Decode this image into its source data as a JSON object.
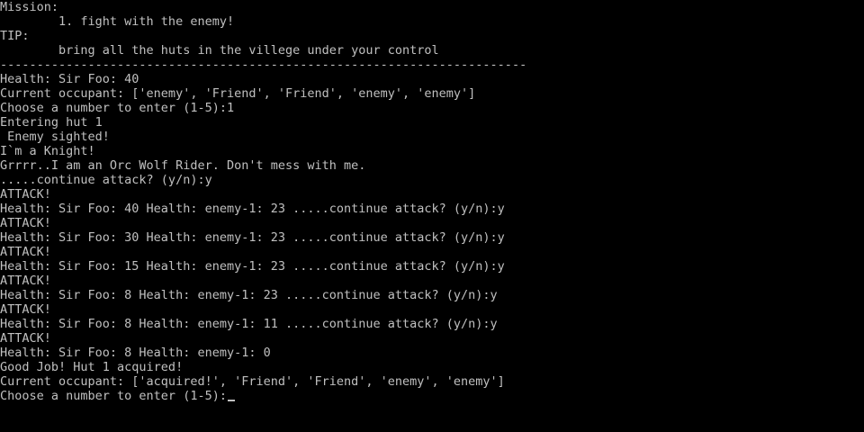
{
  "console": {
    "colors": {
      "background": "#000000",
      "text": "#c0c0c0"
    },
    "lines": [
      "Mission:",
      "        1. fight with the enemy!",
      "TIP:",
      "        bring all the huts in the villege under your control",
      "------------------------------------------------------------------------",
      "Health: Sir Foo: 40",
      "Current occupant: ['enemy', 'Friend', 'Friend', 'enemy', 'enemy']",
      "Choose a number to enter (1-5):1",
      "Entering hut 1",
      " Enemy sighted!",
      "I`m a Knight!",
      "Grrrr..I am an Orc Wolf Rider. Don't mess with me.",
      ".....continue attack? (y/n):y",
      "ATTACK!",
      "Health: Sir Foo: 40 Health: enemy-1: 23 .....continue attack? (y/n):y",
      "ATTACK!",
      "Health: Sir Foo: 30 Health: enemy-1: 23 .....continue attack? (y/n):y",
      "ATTACK!",
      "Health: Sir Foo: 15 Health: enemy-1: 23 .....continue attack? (y/n):y",
      "ATTACK!",
      "Health: Sir Foo: 8 Health: enemy-1: 23 .....continue attack? (y/n):y",
      "ATTACK!",
      "Health: Sir Foo: 8 Health: enemy-1: 11 .....continue attack? (y/n):y",
      "ATTACK!",
      "Health: Sir Foo: 8 Health: enemy-1: 0",
      "Good Job! Hut 1 acquired!",
      "Current occupant: ['acquired!', 'Friend', 'Friend', 'enemy', 'enemy']",
      "Choose a number to enter (1-5):"
    ]
  }
}
